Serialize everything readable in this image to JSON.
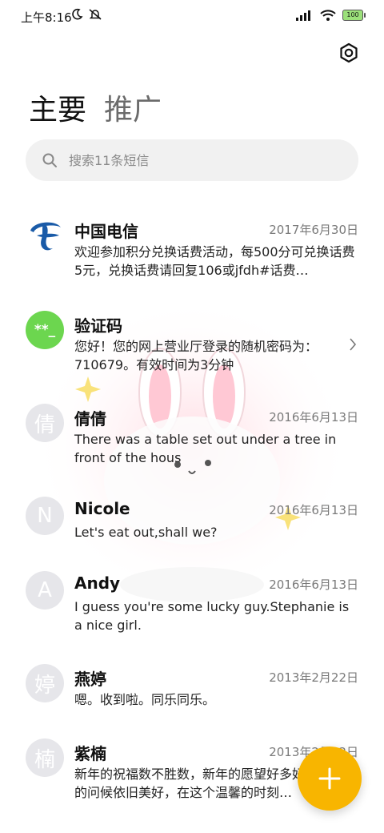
{
  "status": {
    "time": "上午8:16",
    "battery": "100"
  },
  "tabs": {
    "main": "主要",
    "promo": "推广"
  },
  "search": {
    "placeholder": "搜索11条短信"
  },
  "conversations": [
    {
      "name": "中国电信",
      "date": "2017年6月30日",
      "preview": "欢迎参加积分兑换话费活动，每500分可兑换话费5元，兑换话费请回复106或jfdh#话费…",
      "avatar": "china-telecom-logo"
    },
    {
      "name": "验证码",
      "date": "",
      "preview": "您好！您的网上营业厅登录的随机密码为：710679。有效时间为3分钟",
      "avatar_text": "**_",
      "avatar_color": "#6cd64f"
    },
    {
      "name": "倩倩",
      "date": "2016年6月13日",
      "preview": "There was a table set out under a tree in front of the hous",
      "avatar_text": "倩"
    },
    {
      "name": "Nicole",
      "date": "2016年6月13日",
      "preview": "Let's eat out,shall we?",
      "avatar_text": "N"
    },
    {
      "name": "Andy",
      "date": "2016年6月13日",
      "preview": "I guess you're some lucky guy.Stephanie is a nice girl.",
      "avatar_text": "A"
    },
    {
      "name": "燕婷",
      "date": "2013年2月22日",
      "preview": "嗯。收到啦。同乐同乐。",
      "avatar_text": "婷"
    },
    {
      "name": "紫楠",
      "date": "2013年2月22日",
      "preview": "新年的祝福数不胜数，新年的愿望好多好多，新年的问候依旧美好，在这个温馨的时刻…",
      "avatar_text": "楠"
    }
  ],
  "colors": {
    "fab": "#f8b500",
    "telecom_blue": "#1a5ba8",
    "verify_green": "#6cd64f"
  },
  "icons": {
    "settings": "settings-icon",
    "search": "search-icon",
    "add": "plus-icon"
  }
}
